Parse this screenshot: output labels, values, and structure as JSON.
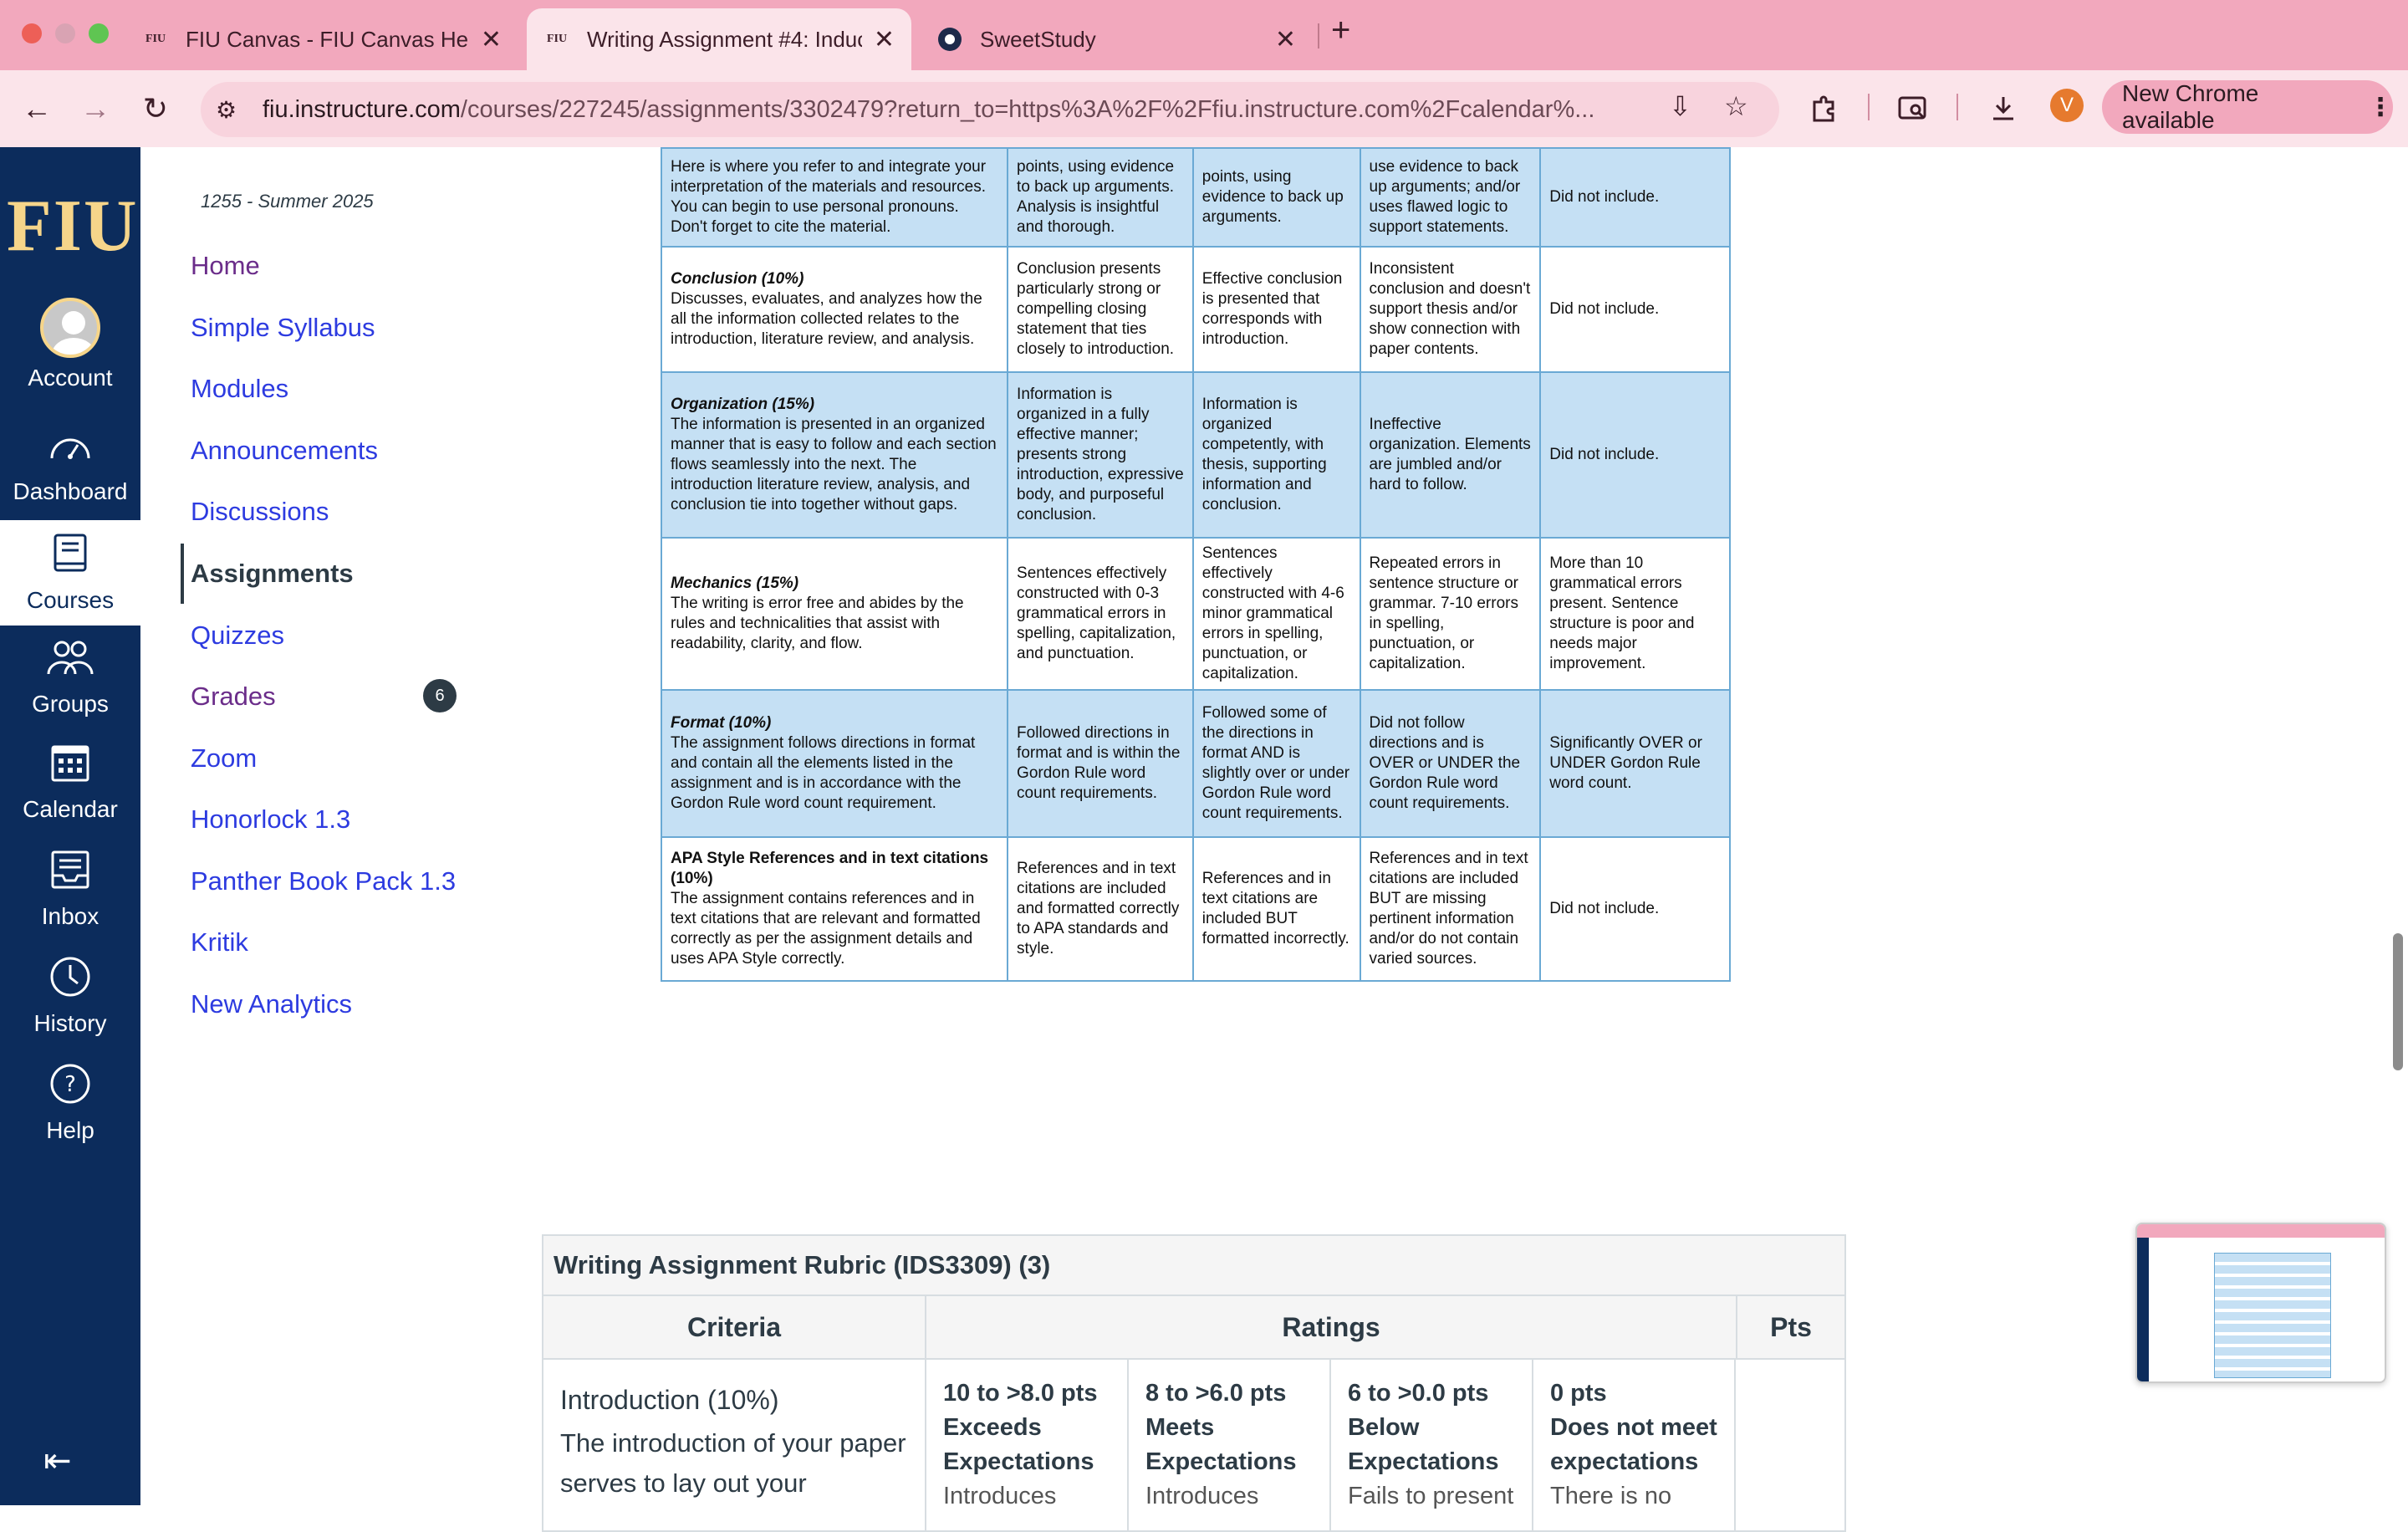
{
  "browser": {
    "tabs": [
      {
        "favicon": "FIU",
        "title": "FIU Canvas - FIU Canvas Help",
        "active": false
      },
      {
        "favicon": "FIU",
        "title": "Writing Assignment #4: Induc",
        "active": true
      },
      {
        "favicon": "sweetstudy-icon",
        "title": "SweetStudy",
        "active": false
      }
    ],
    "url_host": "fiu.instructure.com",
    "url_path": "/courses/227245/assignments/3302479?return_to=https%3A%2F%2Ffiu.instructure.com%2Fcalendar%...",
    "profile_initial": "V",
    "update_label": "New Chrome available"
  },
  "global_nav": {
    "logo": "FIU",
    "items": [
      {
        "label": "Account",
        "icon": "account-avatar-icon"
      },
      {
        "label": "Dashboard",
        "icon": "dashboard-icon"
      },
      {
        "label": "Courses",
        "icon": "courses-icon",
        "active": true
      },
      {
        "label": "Groups",
        "icon": "groups-icon"
      },
      {
        "label": "Calendar",
        "icon": "calendar-icon"
      },
      {
        "label": "Inbox",
        "icon": "inbox-icon"
      },
      {
        "label": "History",
        "icon": "history-icon"
      },
      {
        "label": "Help",
        "icon": "help-icon"
      }
    ]
  },
  "course_nav": {
    "term": "1255 - Summer 2025",
    "items": [
      {
        "label": "Home"
      },
      {
        "label": "Simple Syllabus"
      },
      {
        "label": "Modules"
      },
      {
        "label": "Announcements"
      },
      {
        "label": "Discussions"
      },
      {
        "label": "Assignments",
        "active": true
      },
      {
        "label": "Quizzes"
      },
      {
        "label": "Grades",
        "badge": "6"
      },
      {
        "label": "Zoom"
      },
      {
        "label": "Honorlock 1.3"
      },
      {
        "label": "Panther Book Pack 1.3"
      },
      {
        "label": "Kritik"
      },
      {
        "label": "New Analytics"
      }
    ]
  },
  "image_rubric": {
    "rows": [
      {
        "style": "blue",
        "title": "",
        "desc": "Here is where you refer to and integrate your interpretation of the materials and resources. You can begin to use personal pronouns. Don't forget to cite the material.",
        "cells": [
          "points, using evidence to back up arguments. Analysis is insightful and thorough.",
          "points, using evidence to back up arguments.",
          "use evidence to back up arguments; and/or uses flawed logic to support statements.",
          "Did not include."
        ]
      },
      {
        "style": "white",
        "title": "Conclusion (10%)",
        "desc": "Discusses, evaluates, and analyzes how the all the information collected relates to the introduction, literature review, and analysis.",
        "cells": [
          "Conclusion presents particularly strong or compelling closing statement that ties closely to introduction.",
          "Effective conclusion is presented that corresponds with introduction.",
          "Inconsistent conclusion and doesn't support thesis and/or show connection with paper contents.",
          "Did not include."
        ]
      },
      {
        "style": "blue",
        "title": "Organization (15%)",
        "desc": "The information is presented in an organized manner that is easy to follow and each section flows seamlessly into the next. The introduction literature review, analysis, and conclusion tie into together without gaps.",
        "cells": [
          "Information is organized in a fully effective manner; presents strong introduction, expressive body, and purposeful conclusion.",
          "Information is organized competently, with thesis, supporting information and conclusion.",
          "Ineffective organization. Elements are jumbled and/or hard to follow.",
          "Did not include."
        ]
      },
      {
        "style": "white",
        "title": "Mechanics (15%)",
        "desc": "The writing is error free and abides by the rules and technicalities that assist with readability, clarity, and flow.",
        "cells": [
          "Sentences effectively constructed with 0-3 grammatical errors in spelling, capitalization, and punctuation.",
          "Sentences effectively constructed with 4-6 minor grammatical errors in spelling, punctuation, or capitalization.",
          "Repeated errors in sentence structure or grammar. 7-10 errors in spelling, punctuation, or capitalization.",
          "More than 10 grammatical errors present. Sentence structure is poor and needs major improvement."
        ]
      },
      {
        "style": "blue",
        "title": "Format (10%)",
        "desc": "The assignment follows directions in format and contain all the elements listed in the assignment and is in accordance with the Gordon Rule word count requirement.",
        "cells": [
          "Followed directions in format and is within the Gordon Rule word count requirements.",
          "Followed some of the directions in format AND is slightly over or under Gordon Rule word count requirements.",
          "Did not follow directions and is OVER or UNDER the Gordon Rule word count requirements.",
          "Significantly OVER or UNDER Gordon Rule word count."
        ]
      },
      {
        "style": "white",
        "title": "APA Style References and in text citations (10%)",
        "desc": "The assignment contains references and in text citations that are relevant and formatted correctly as per the assignment details and uses APA Style correctly.",
        "cells": [
          "References and in text citations are included and formatted correctly to APA standards and style.",
          "References and in text citations are included BUT formatted incorrectly.",
          "References and in text citations are included BUT are missing pertinent information and/or do not contain varied sources.",
          "Did not include."
        ]
      }
    ]
  },
  "canvas_rubric": {
    "title": "Writing Assignment Rubric (IDS3309) (3)",
    "col_criteria": "Criteria",
    "col_ratings": "Ratings",
    "col_pts": "Pts",
    "row": {
      "criterion": "Introduction (10%)",
      "description": "The introduction of your paper serves to lay out your",
      "ratings": [
        {
          "points": "10 to >8.0 pts",
          "label": "Exceeds Expectations",
          "more": "Introduces"
        },
        {
          "points": "8 to >6.0 pts",
          "label": "Meets Expectations",
          "more": "Introduces"
        },
        {
          "points": "6 to >0.0 pts",
          "label": "Below Expectations",
          "more": "Fails to present"
        },
        {
          "points": "0 pts",
          "label": "Does not meet expectations",
          "more": "There is no"
        }
      ]
    }
  },
  "colors": {
    "nav_bg": "#0c2c5c",
    "link": "#2d3be0",
    "rubric_blue": "#c5e0f4",
    "tab_strip": "#f2a8bd"
  }
}
